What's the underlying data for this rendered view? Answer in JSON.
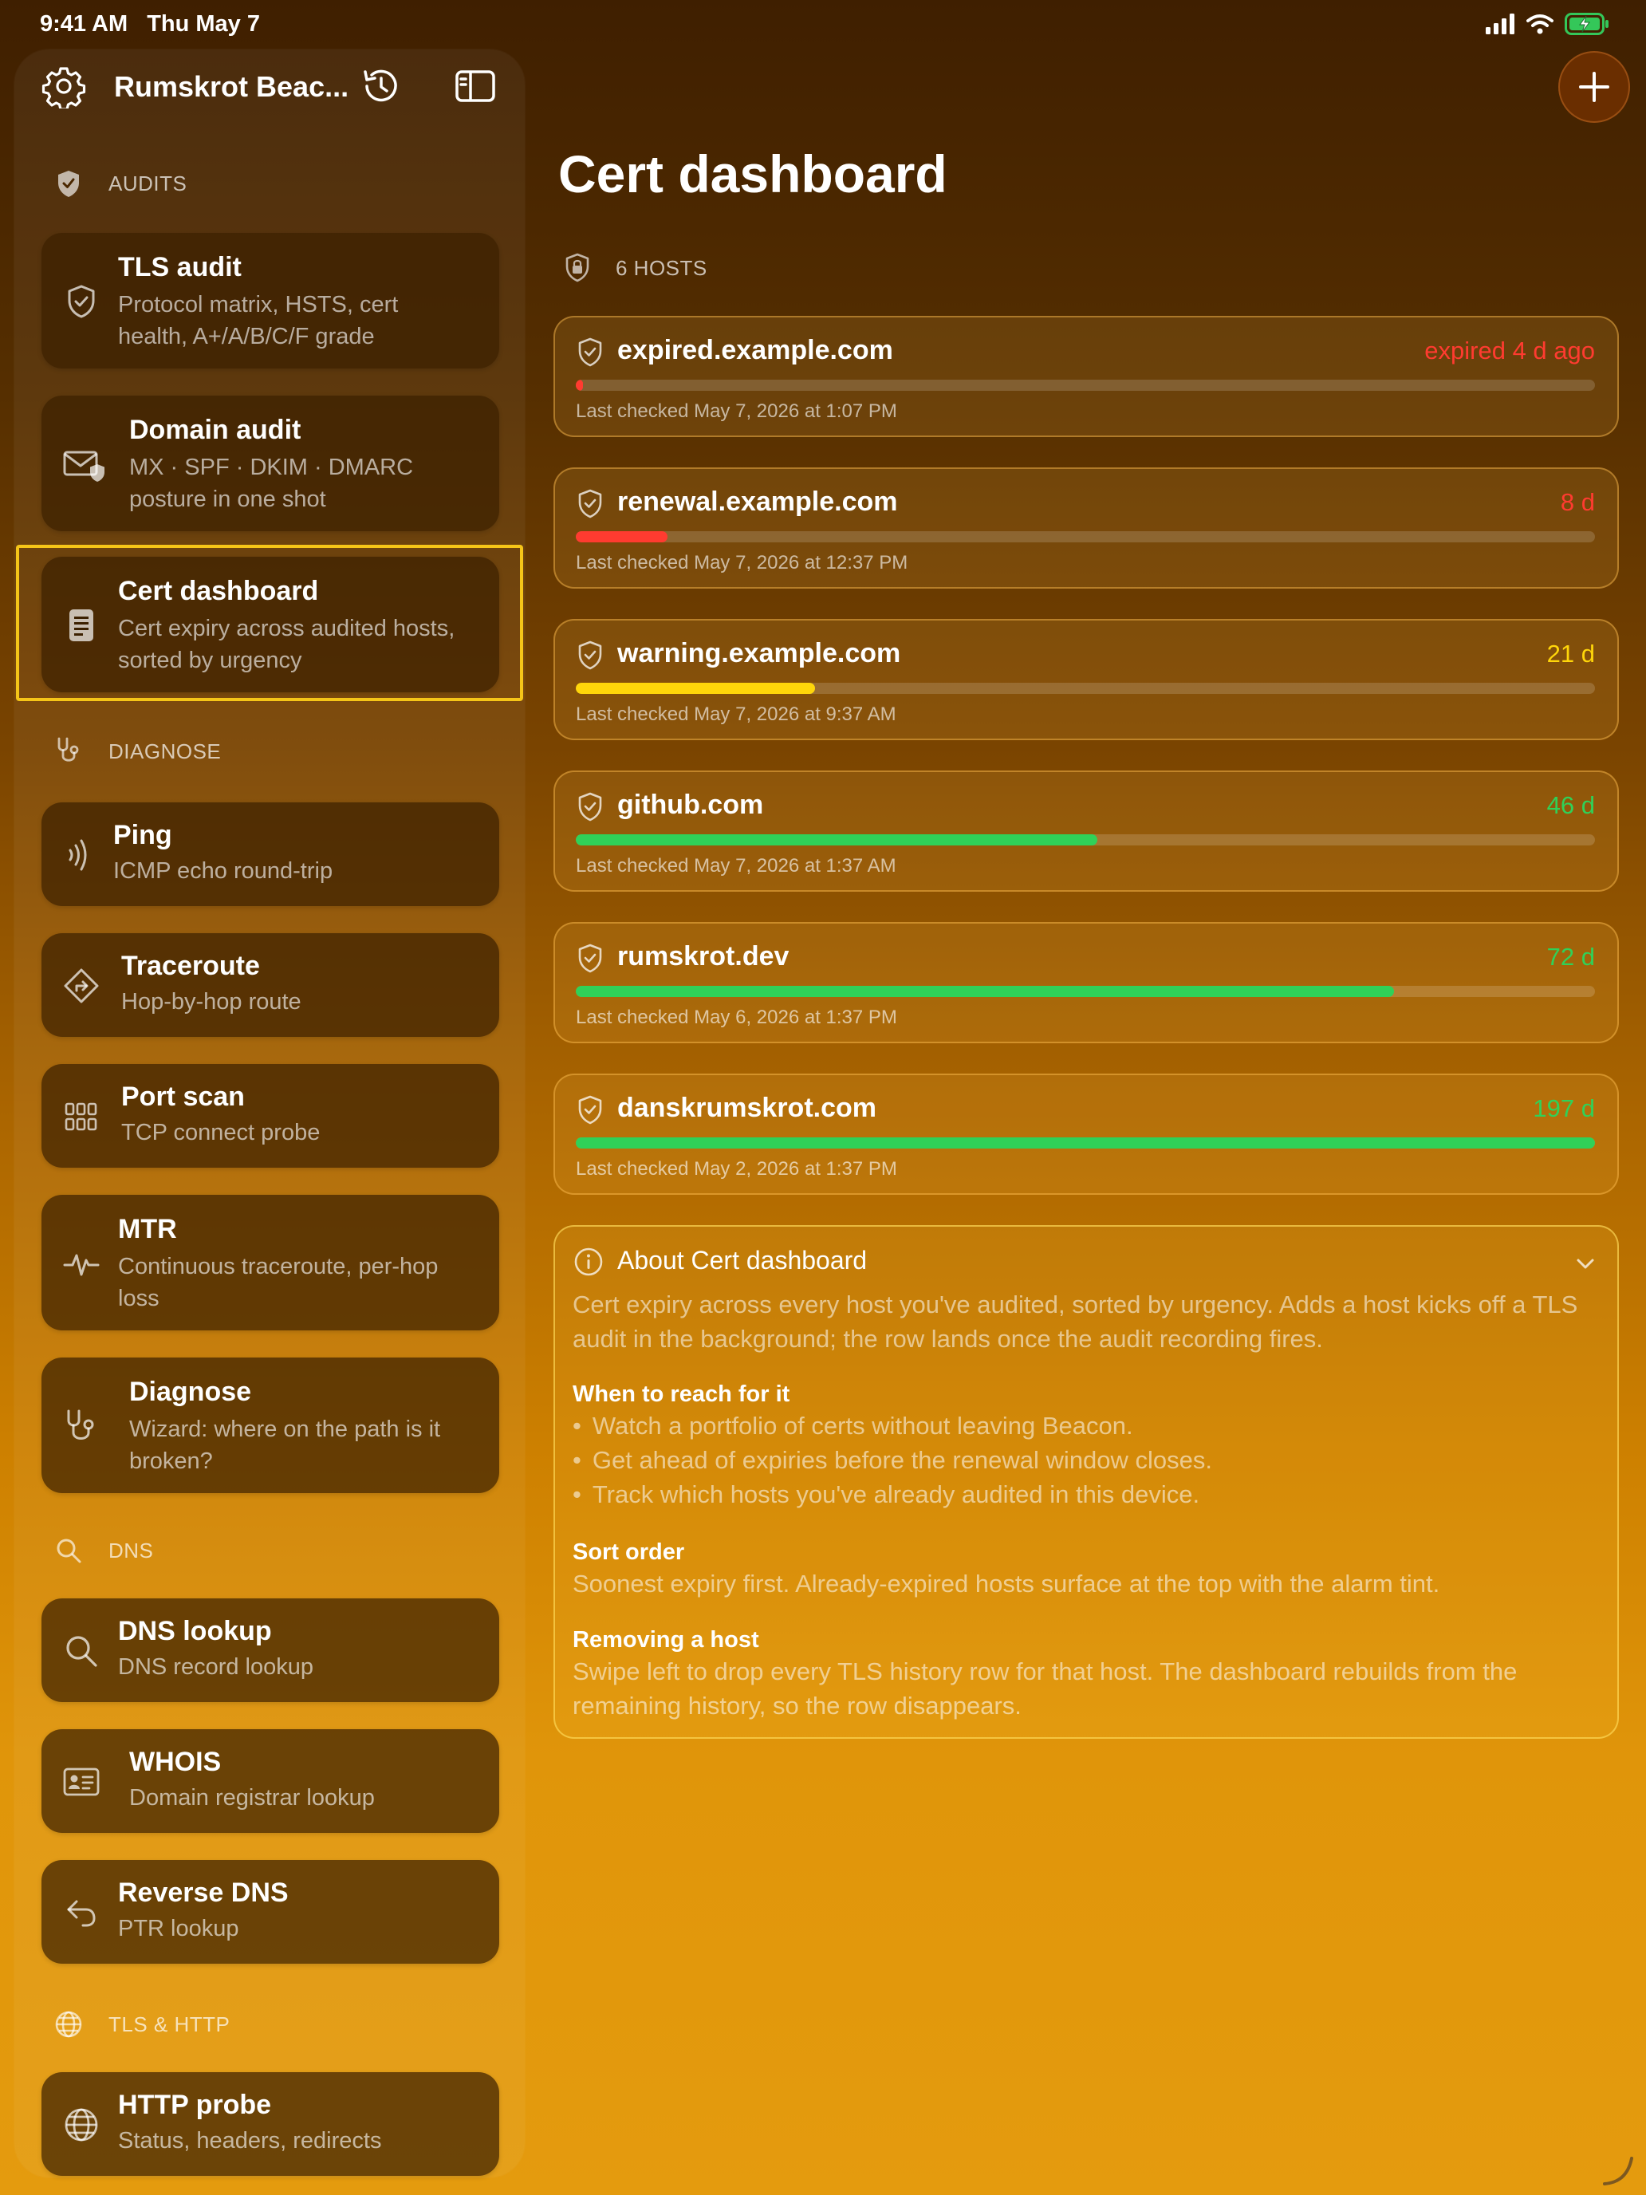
{
  "status_bar": {
    "time": "9:41 AM",
    "date": "Thu May 7"
  },
  "sidebar": {
    "title": "Rumskrot Beac...",
    "sections": {
      "audits": "AUDITS",
      "diagnose": "DIAGNOSE",
      "dns": "DNS",
      "tls_http": "TLS & HTTP"
    },
    "items": [
      {
        "title": "TLS audit",
        "subtitle": "Protocol matrix, HSTS, cert health, A+/A/B/C/F grade",
        "icon": "shield-check-icon"
      },
      {
        "title": "Domain audit",
        "subtitle": "MX · SPF · DKIM · DMARC posture in one shot",
        "icon": "envelope-shield-icon"
      },
      {
        "title": "Cert dashboard",
        "subtitle": "Cert expiry across audited hosts, sorted by urgency",
        "icon": "document-text-icon"
      },
      {
        "title": "Ping",
        "subtitle": "ICMP echo round-trip",
        "icon": "wave-icon"
      },
      {
        "title": "Traceroute",
        "subtitle": "Hop-by-hop route",
        "icon": "route-diamond-icon"
      },
      {
        "title": "Port scan",
        "subtitle": "TCP connect probe",
        "icon": "grid-icon"
      },
      {
        "title": "MTR",
        "subtitle": "Continuous traceroute, per-hop loss",
        "icon": "waveform-icon"
      },
      {
        "title": "Diagnose",
        "subtitle": "Wizard: where on the path is it broken?",
        "icon": "stethoscope-icon"
      },
      {
        "title": "DNS lookup",
        "subtitle": "DNS record lookup",
        "icon": "magnifier-icon"
      },
      {
        "title": "WHOIS",
        "subtitle": "Domain registrar lookup",
        "icon": "id-card-icon"
      },
      {
        "title": "Reverse DNS",
        "subtitle": "PTR lookup",
        "icon": "return-arrow-icon"
      },
      {
        "title": "HTTP probe",
        "subtitle": "Status, headers, redirects",
        "icon": "globe-icon"
      }
    ],
    "selected_item": "Cert dashboard"
  },
  "main": {
    "title": "Cert dashboard",
    "hosts_header": "6 HOSTS",
    "hosts": [
      {
        "name": "expired.example.com",
        "days": "expired 4 d ago",
        "last_checked": "Last checked May 7, 2026 at 1:07 PM",
        "progress": 0.007,
        "color": "#ff3b30"
      },
      {
        "name": "renewal.example.com",
        "days": "8 d",
        "last_checked": "Last checked May 7, 2026 at 12:37 PM",
        "progress": 0.09,
        "color": "#ff3b30"
      },
      {
        "name": "warning.example.com",
        "days": "21 d",
        "last_checked": "Last checked May 7, 2026 at 9:37 AM",
        "progress": 0.235,
        "color": "#ffd60a"
      },
      {
        "name": "github.com",
        "days": "46 d",
        "last_checked": "Last checked May 7, 2026 at 1:37 AM",
        "progress": 0.512,
        "color": "#30d158"
      },
      {
        "name": "rumskrot.dev",
        "days": "72 d",
        "last_checked": "Last checked May 6, 2026 at 1:37 PM",
        "progress": 0.803,
        "color": "#30d158"
      },
      {
        "name": "danskrumskrot.com",
        "days": "197 d",
        "last_checked": "Last checked May 2, 2026 at 1:37 PM",
        "progress": 1.0,
        "color": "#30d158"
      }
    ],
    "about": {
      "title": "About Cert dashboard",
      "intro": "Cert expiry across every host you've audited, sorted by urgency. Adds a host kicks off a TLS audit in the background; the row lands once the audit recording fires.",
      "when_heading": "When to reach for it",
      "bullets": [
        "Watch a portfolio of certs without leaving Beacon.",
        "Get ahead of expiries before the renewal window closes.",
        "Track which hosts you've already audited in this device."
      ],
      "sort_heading": "Sort order",
      "sort_text": "Soonest expiry first. Already-expired hosts surface at the top with the alarm tint.",
      "remove_heading": "Removing a host",
      "remove_text": "Swipe left to drop every TLS history row for that host. The dashboard rebuilds from the remaining history, so the row disappears."
    }
  }
}
